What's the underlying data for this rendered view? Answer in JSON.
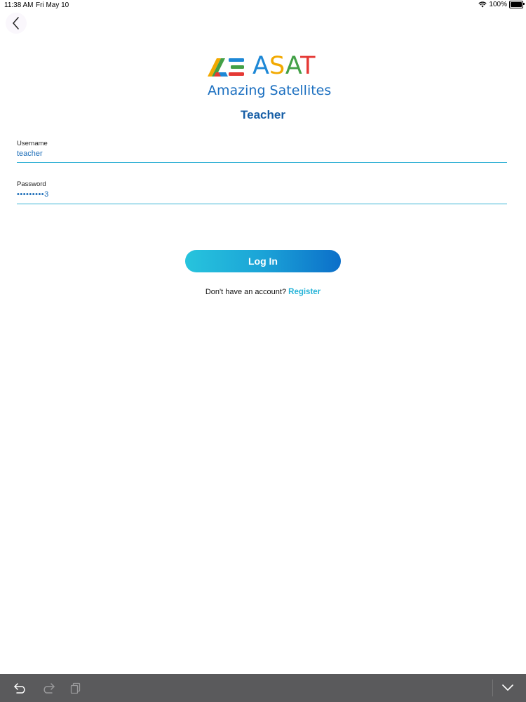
{
  "status_bar": {
    "time": "11:38 AM",
    "date": "Fri May 10",
    "battery": "100%",
    "icons": [
      "wifi-icon",
      "battery-icon"
    ]
  },
  "header": {
    "back_icon": "chevron-left-icon"
  },
  "logo": {
    "wordmark_letters": [
      "A",
      "S",
      "A",
      "T"
    ],
    "wordmark_colors": [
      "#1e88d6",
      "#f2a900",
      "#43a047",
      "#e53935"
    ],
    "tagline": "Amazing Satellites"
  },
  "page": {
    "role_title": "Teacher"
  },
  "form": {
    "username_label": "Username",
    "username_value": "teacher",
    "password_label": "Password",
    "password_value": "•••••••••3",
    "login_label": "Log In"
  },
  "register": {
    "prompt": "Don't have an account?",
    "link_label": "Register"
  },
  "bottom_toolbar": {
    "icons": [
      "undo-icon",
      "redo-icon",
      "clipboard-icon",
      "chevron-down-icon"
    ]
  },
  "colors": {
    "accent": "#1c6db8",
    "title": "#165ea6",
    "link": "#27b4d8",
    "toolbar_bg": "#5a5a5c"
  }
}
